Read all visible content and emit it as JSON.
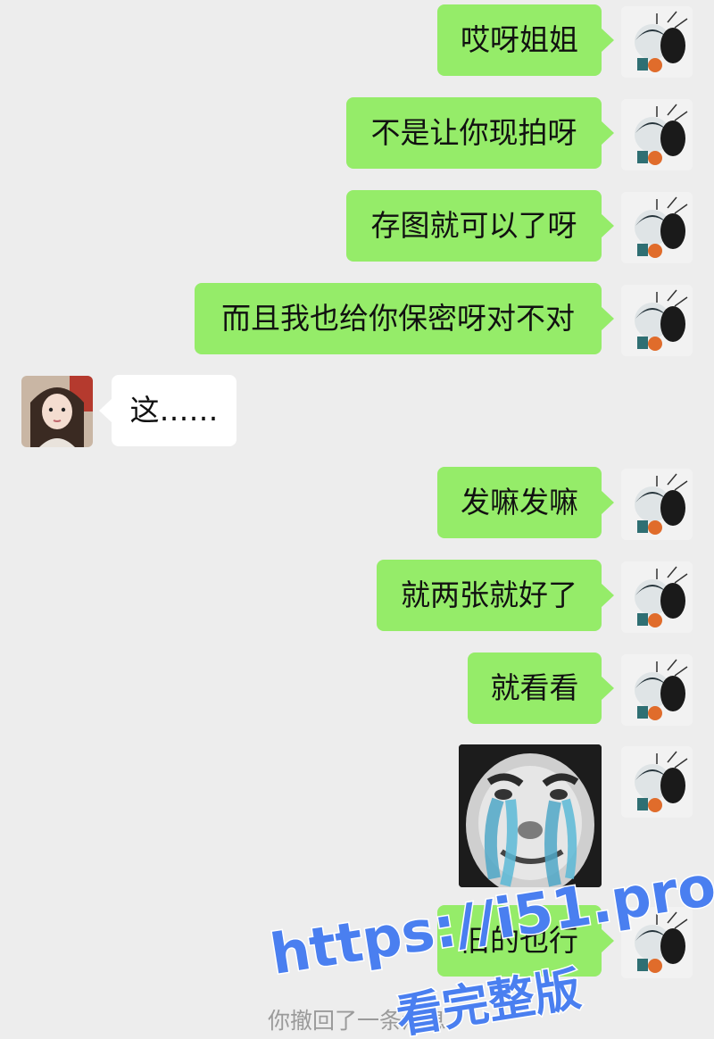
{
  "messages": [
    {
      "side": "out",
      "text": "哎呀姐姐"
    },
    {
      "side": "out",
      "text": "不是让你现拍呀"
    },
    {
      "side": "out",
      "text": "存图就可以了呀"
    },
    {
      "side": "out",
      "text": "而且我也给你保密呀对不对"
    },
    {
      "side": "in",
      "text": "这……"
    },
    {
      "side": "out",
      "text": "发嘛发嘛"
    },
    {
      "side": "out",
      "text": "就两张就好了"
    },
    {
      "side": "out",
      "text": "就看看"
    },
    {
      "side": "out",
      "type": "sticker",
      "icon": "crying-face-sticker"
    },
    {
      "side": "out",
      "text": "旧的也行"
    }
  ],
  "system_note": "你撤回了一条消息",
  "watermark": {
    "url": "https://i51.pro",
    "sub": "看完整版"
  },
  "colors": {
    "background": "#ededed",
    "outgoing_bubble": "#95ec69",
    "incoming_bubble": "#ffffff",
    "watermark": "#4a7ff0"
  }
}
